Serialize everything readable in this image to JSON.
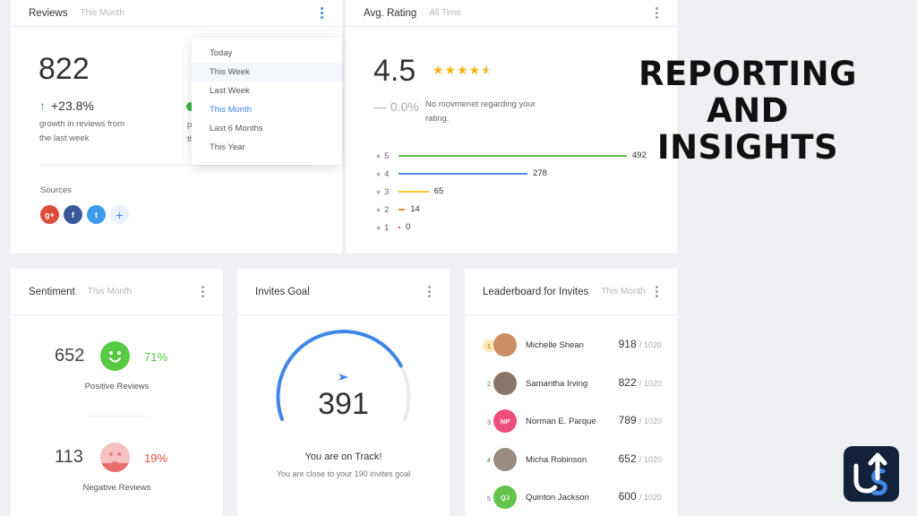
{
  "reviews": {
    "title": "Reviews",
    "period": "This Month",
    "count": "822",
    "growth": "+23.8%",
    "growth_text_1": "growth in reviews from",
    "growth_text_2": "the last week",
    "hidden_p": "p",
    "hidden_th": "th",
    "sources_label": "Sources",
    "sources": [
      {
        "label": "g+",
        "icon": "google-plus-icon",
        "color": "#dd4b39"
      },
      {
        "label": "f",
        "icon": "facebook-icon",
        "color": "#3b5998"
      },
      {
        "label": "t",
        "icon": "twitter-icon",
        "color": "#3e9be9"
      },
      {
        "label": "+",
        "icon": "add-source-icon",
        "color": "#e8f1fc"
      }
    ],
    "dropdown": {
      "items": [
        "Today",
        "This Week",
        "Last Week",
        "This Month",
        "Last 6 Months",
        "This Year"
      ],
      "hovered": "This Week",
      "selected": "This Month"
    }
  },
  "rating": {
    "title": "Avg. Rating",
    "period": "All Time",
    "value": "4.5",
    "stars": 4.5,
    "change": "— 0.0%",
    "note_1": "No movmenet regarding your",
    "note_2": "rating.",
    "bars": [
      {
        "star": "5",
        "count": 492,
        "label": "492",
        "color": "#59c048"
      },
      {
        "star": "4",
        "count": 278,
        "label": "278",
        "color": "#4a90e2"
      },
      {
        "star": "3",
        "count": 65,
        "label": "65",
        "color": "#f5c433"
      },
      {
        "star": "2",
        "count": 14,
        "label": "14",
        "color": "#f08a24"
      },
      {
        "star": "1",
        "count": 0,
        "label": "0",
        "color": "#e74c3c"
      }
    ]
  },
  "headline": {
    "line1": "REPORTING",
    "line2": "AND INSIGHTS"
  },
  "sentiment": {
    "title": "Sentiment",
    "period": "This Month",
    "positive_count": "652",
    "positive_pct": "71%",
    "positive_label": "Positive Reviews",
    "negative_count": "113",
    "negative_pct": "19%",
    "negative_label": "Negative Reviews",
    "colors": {
      "positive": "#58c944",
      "negative": "#e74c3c"
    }
  },
  "invites": {
    "title": "Invites Goal",
    "count": "391",
    "progress": 0.78,
    "status_title": "You are on Track!",
    "status_sub": "You are close to your 190 invites goal"
  },
  "leaderboard": {
    "title": "Leaderboard for Invites",
    "period": "This Month",
    "entries": [
      {
        "rank": "1",
        "name": "Michelle Shean",
        "score": "918",
        "total": "/ 1020",
        "initials": "",
        "color": "#c98f62"
      },
      {
        "rank": "2",
        "name": "Samantha Irving",
        "score": "822",
        "total": "/ 1020",
        "initials": "",
        "color": "#8a7668"
      },
      {
        "rank": "3",
        "name": "Norman E. Parque",
        "score": "789",
        "total": "/ 1020",
        "initials": "NP",
        "color": "#ec4f7c"
      },
      {
        "rank": "4",
        "name": "Micha Robinson",
        "score": "652",
        "total": "/ 1020",
        "initials": "",
        "color": "#9c8b82"
      },
      {
        "rank": "5",
        "name": "Quinton Jackson",
        "score": "600",
        "total": "/ 1020",
        "initials": "QJ",
        "color": "#64c34a"
      }
    ]
  }
}
